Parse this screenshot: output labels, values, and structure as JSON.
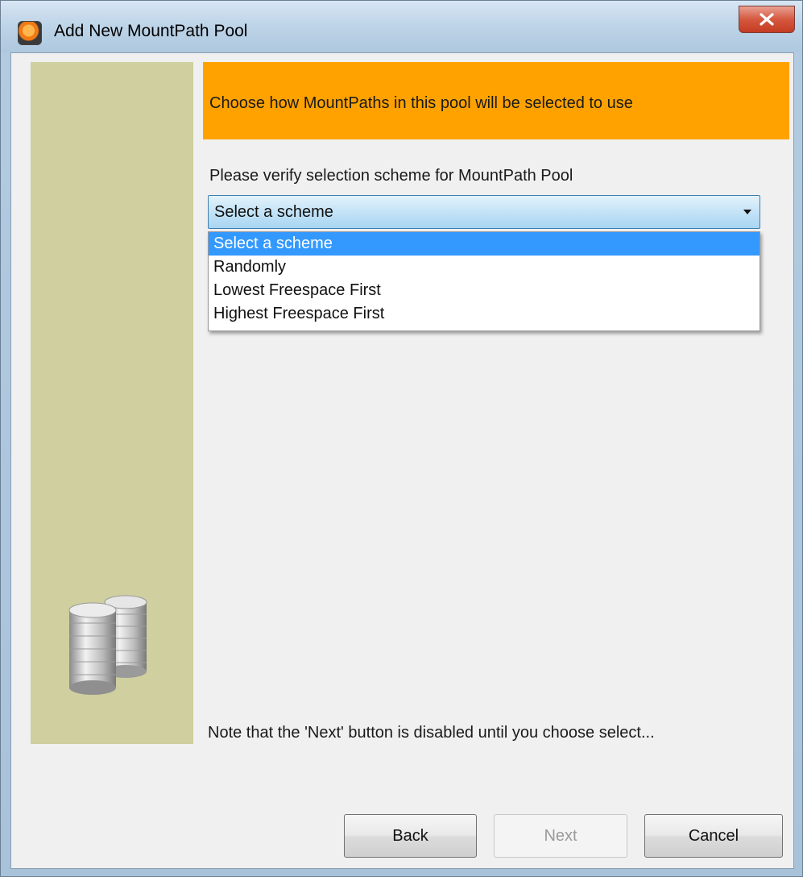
{
  "window": {
    "title": "Add New MountPath Pool",
    "close_label": "X",
    "icon": "app-logo-icon"
  },
  "side_panel": {
    "icon": "coins-stack-icon"
  },
  "header": {
    "text": "Choose how MountPaths in this pool will be selected to use"
  },
  "form": {
    "prompt": "Please verify selection scheme for MountPath Pool",
    "scheme_select": {
      "value": "Select a scheme",
      "options": [
        "Select a scheme",
        "Randomly",
        "Lowest Freespace First",
        "Highest Freespace First"
      ],
      "highlighted_option": "Select a scheme"
    },
    "note": "Note that the 'Next' button is disabled until you choose select..."
  },
  "buttons": {
    "back": "Back",
    "next": "Next",
    "cancel": "Cancel",
    "next_enabled": false
  },
  "colors": {
    "header_banner": "#ffa200",
    "side_panel": "#cfcf9f",
    "selection_highlight": "#3399ff"
  }
}
